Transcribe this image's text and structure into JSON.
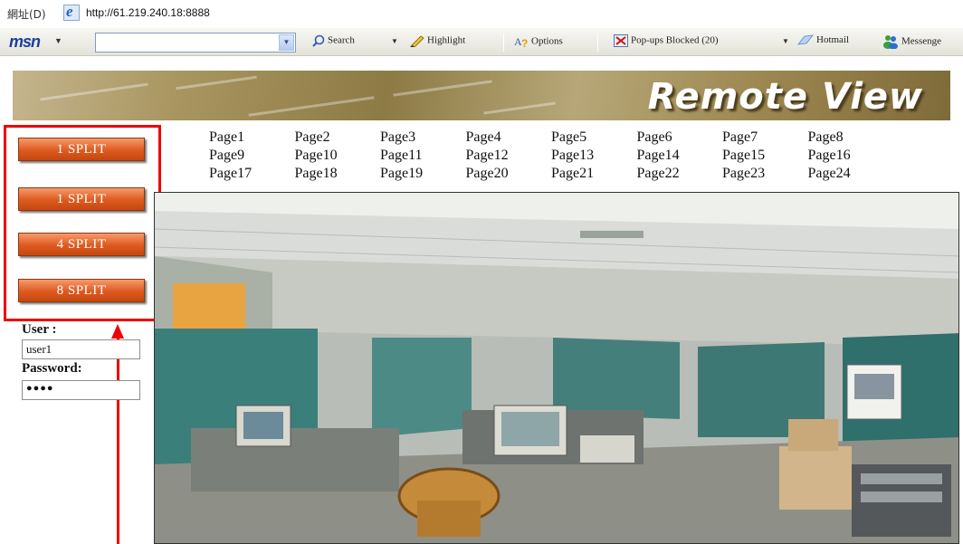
{
  "address_bar": {
    "label": "網址(D)",
    "url": "http://61.219.240.18:8888"
  },
  "toolbar": {
    "logo": "msn",
    "search": "Search",
    "highlight": "Highlight",
    "options": "Options",
    "popups": "Pop-ups Blocked (20)",
    "hotmail": "Hotmail",
    "messenger": "Messenge"
  },
  "banner": {
    "title": "Remote View"
  },
  "split_buttons": [
    "1 SPLIT",
    "1 SPLIT",
    "4 SPLIT",
    "8 SPLIT"
  ],
  "login": {
    "user_label": "User :",
    "user_value": "user1",
    "password_label": "Password:",
    "password_value": "●●●●"
  },
  "pages": [
    "Page1",
    "Page2",
    "Page3",
    "Page4",
    "Page5",
    "Page6",
    "Page7",
    "Page8",
    "Page9",
    "Page10",
    "Page11",
    "Page12",
    "Page13",
    "Page14",
    "Page15",
    "Page16",
    "Page17",
    "Page18",
    "Page19",
    "Page20",
    "Page21",
    "Page22",
    "Page23",
    "Page24"
  ],
  "colors": {
    "split_button": "#dd5a1f",
    "annotation": "#ee0000",
    "banner": "#8d7a45"
  }
}
